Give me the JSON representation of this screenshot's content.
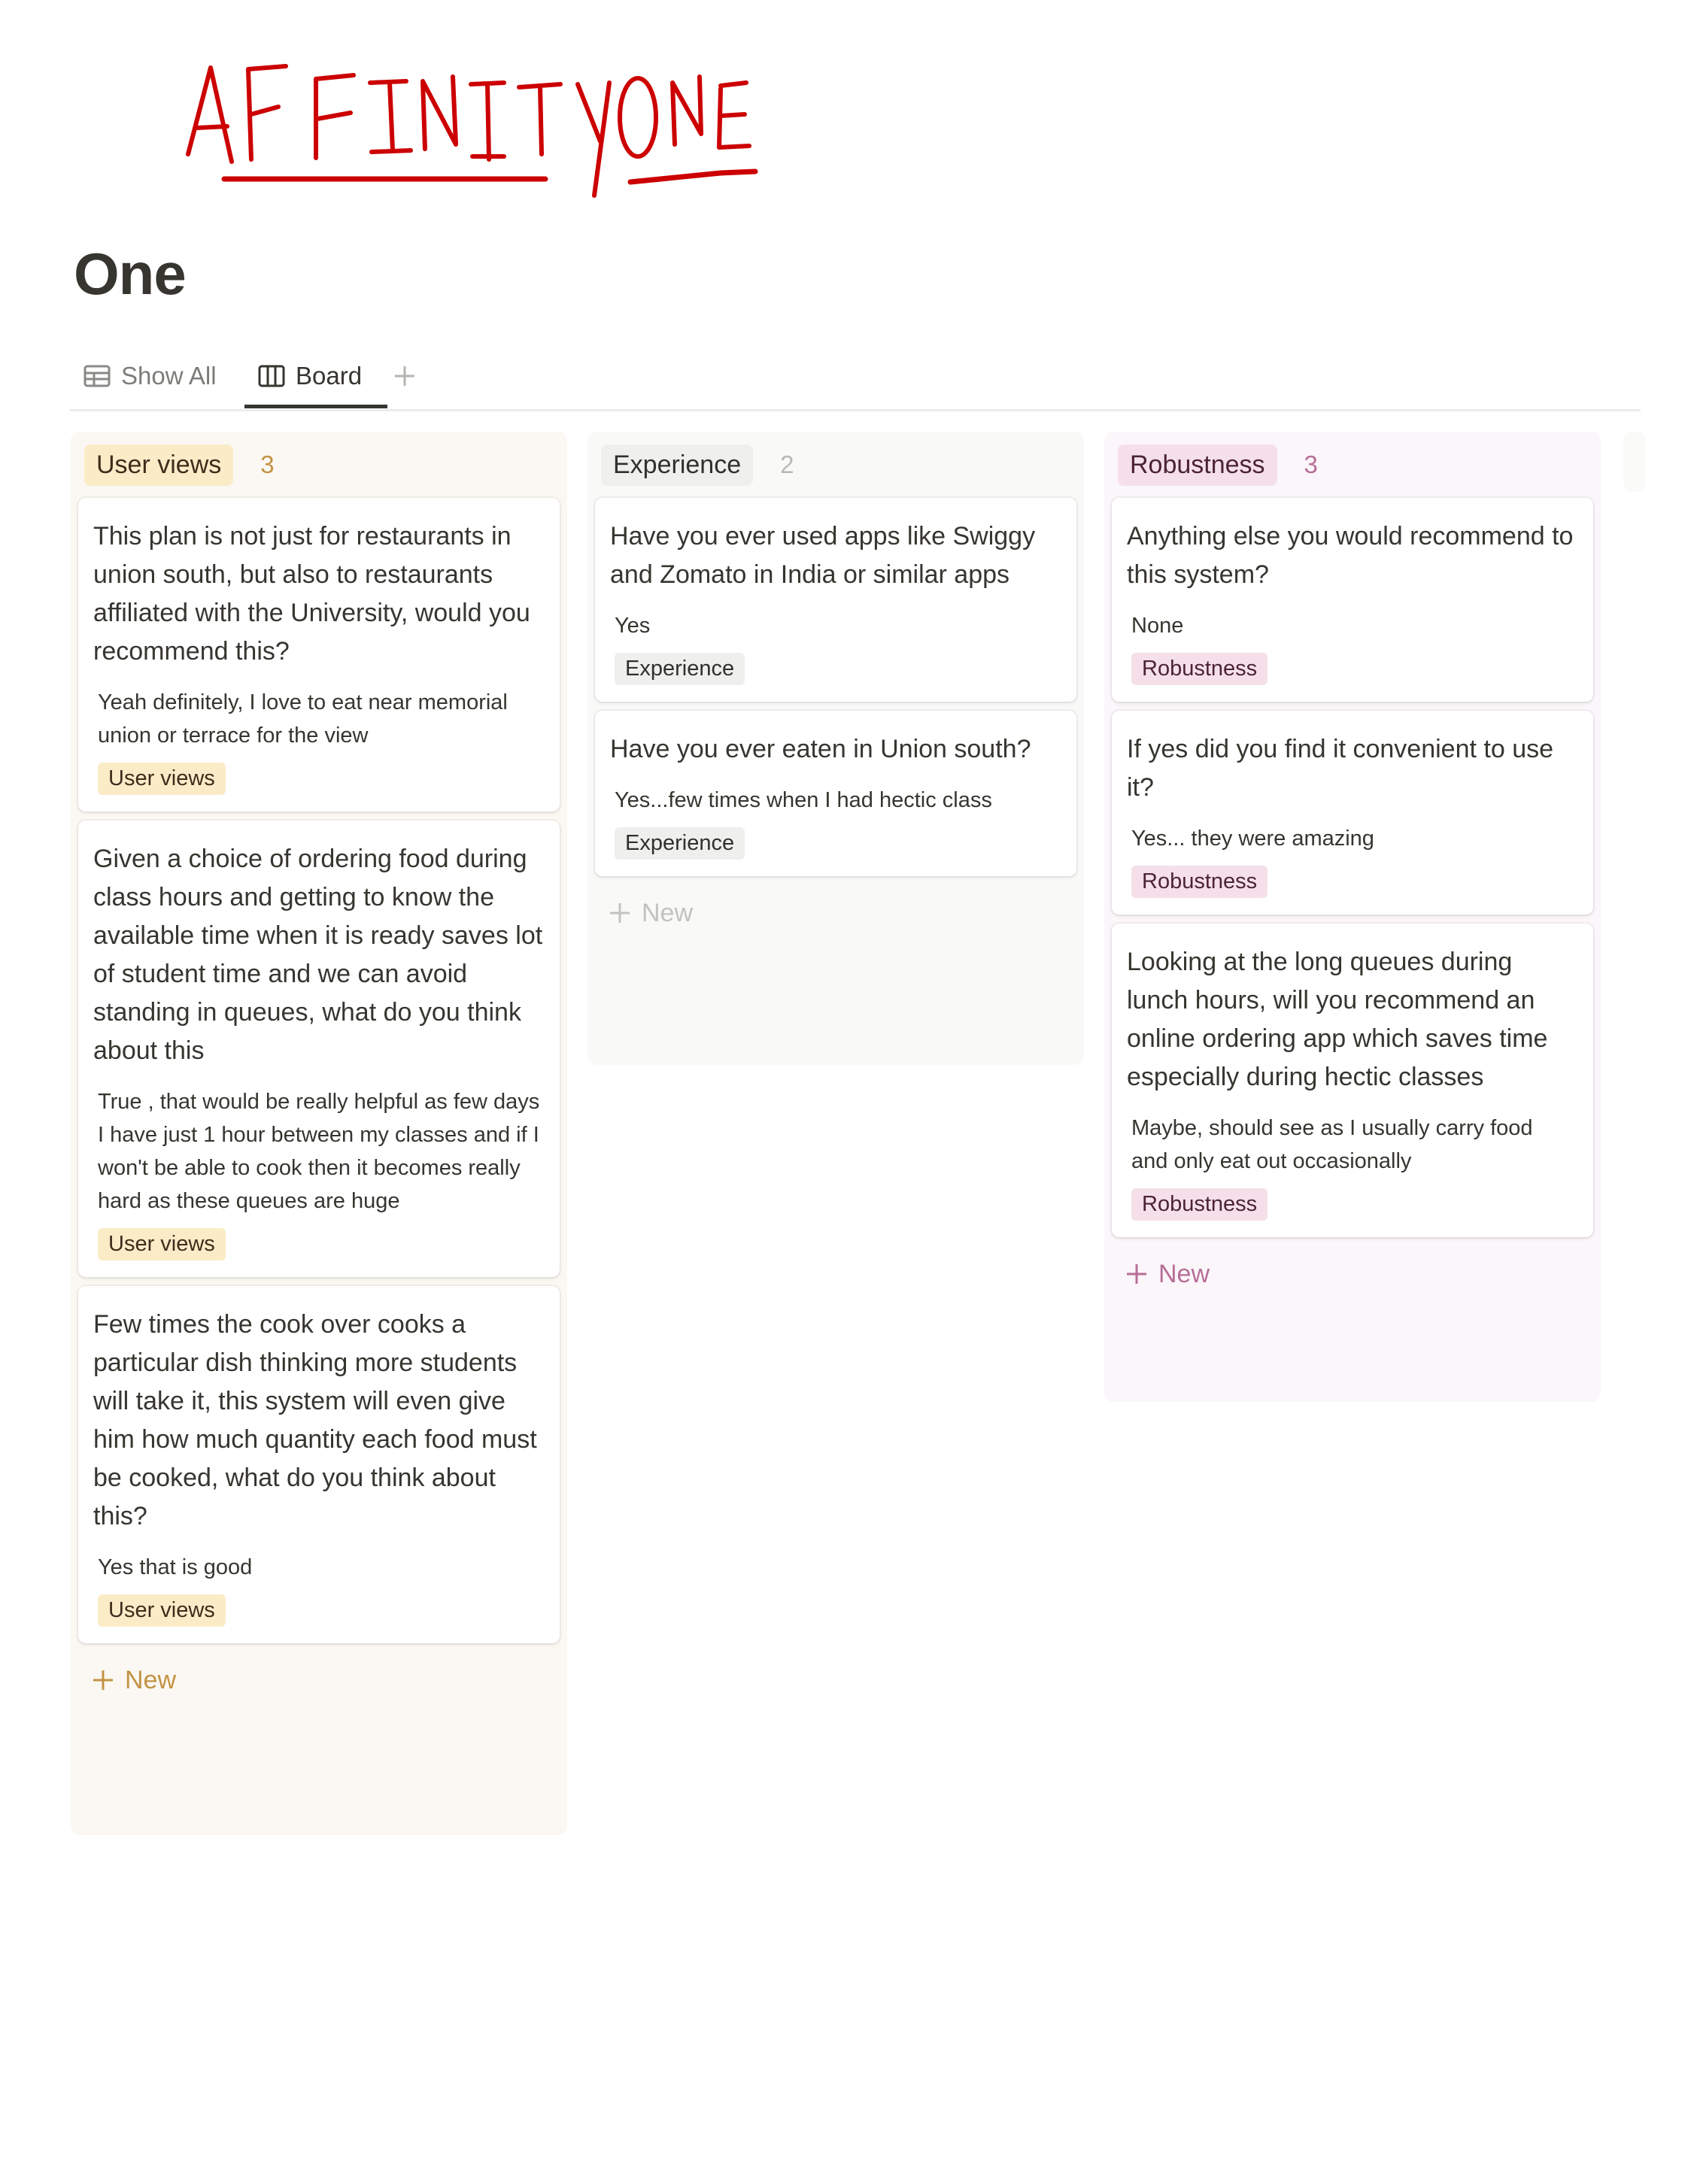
{
  "annotation": {
    "text": "AFFINITY ONE",
    "color": "#cc0000"
  },
  "page": {
    "title": "One"
  },
  "views": {
    "tabs": [
      {
        "label": "Show All",
        "icon": "table-icon",
        "active": false
      },
      {
        "label": "Board",
        "icon": "board-icon",
        "active": true
      }
    ],
    "add_view_icon": "plus-icon"
  },
  "board": {
    "columns": [
      {
        "name": "User views",
        "count": "3",
        "chip_bg": "#fbecc8",
        "accent": "#c29343",
        "new_label": "New",
        "cards": [
          {
            "title": "This plan is not just for restaurants in union south, but also to restaurants affiliated with the University, would you recommend this?",
            "answer": "Yeah definitely, I love to eat near memorial union or terrace for the view",
            "tag": "User views"
          },
          {
            "title": "Given a choice of ordering food during class hours and getting to know the available time when it is ready saves lot of student time and we can avoid standing in queues, what do you think about this",
            "answer": "True , that would be really helpful as few days I have just 1 hour between my classes and if I won't be able to cook then it becomes really hard as these queues are huge",
            "tag": "User views"
          },
          {
            "title": "Few times the cook over cooks a particular dish thinking more students will take it, this system will even give him how much quantity each food must be cooked, what do you think about this?",
            "answer": "Yes that is good",
            "tag": "User views"
          }
        ]
      },
      {
        "name": "Experience",
        "count": "2",
        "chip_bg": "#efefed",
        "accent": "#b9b8b5",
        "new_label": "New",
        "cards": [
          {
            "title": "Have you ever used apps like Swiggy and Zomato in India or similar apps",
            "answer": "Yes",
            "tag": "Experience"
          },
          {
            "title": "Have you ever eaten in Union south?",
            "answer": "Yes...few times when I had hectic class",
            "tag": "Experience"
          }
        ]
      },
      {
        "name": "Robustness",
        "count": "3",
        "chip_bg": "#f5e0e9",
        "accent": "#b76e98",
        "new_label": "New",
        "cards": [
          {
            "title": "Anything else you would recommend to this system?",
            "answer": "None",
            "tag": "Robustness"
          },
          {
            "title": "If yes did you find it convenient to use it?",
            "answer": "Yes... they were amazing",
            "tag": "Robustness"
          },
          {
            "title": "Looking at the long queues during lunch hours, will you recommend an online ordering app which saves time especially during hectic classes",
            "answer": "Maybe, should see as I usually carry food and only eat out occasionally",
            "tag": "Robustness"
          }
        ]
      }
    ]
  }
}
